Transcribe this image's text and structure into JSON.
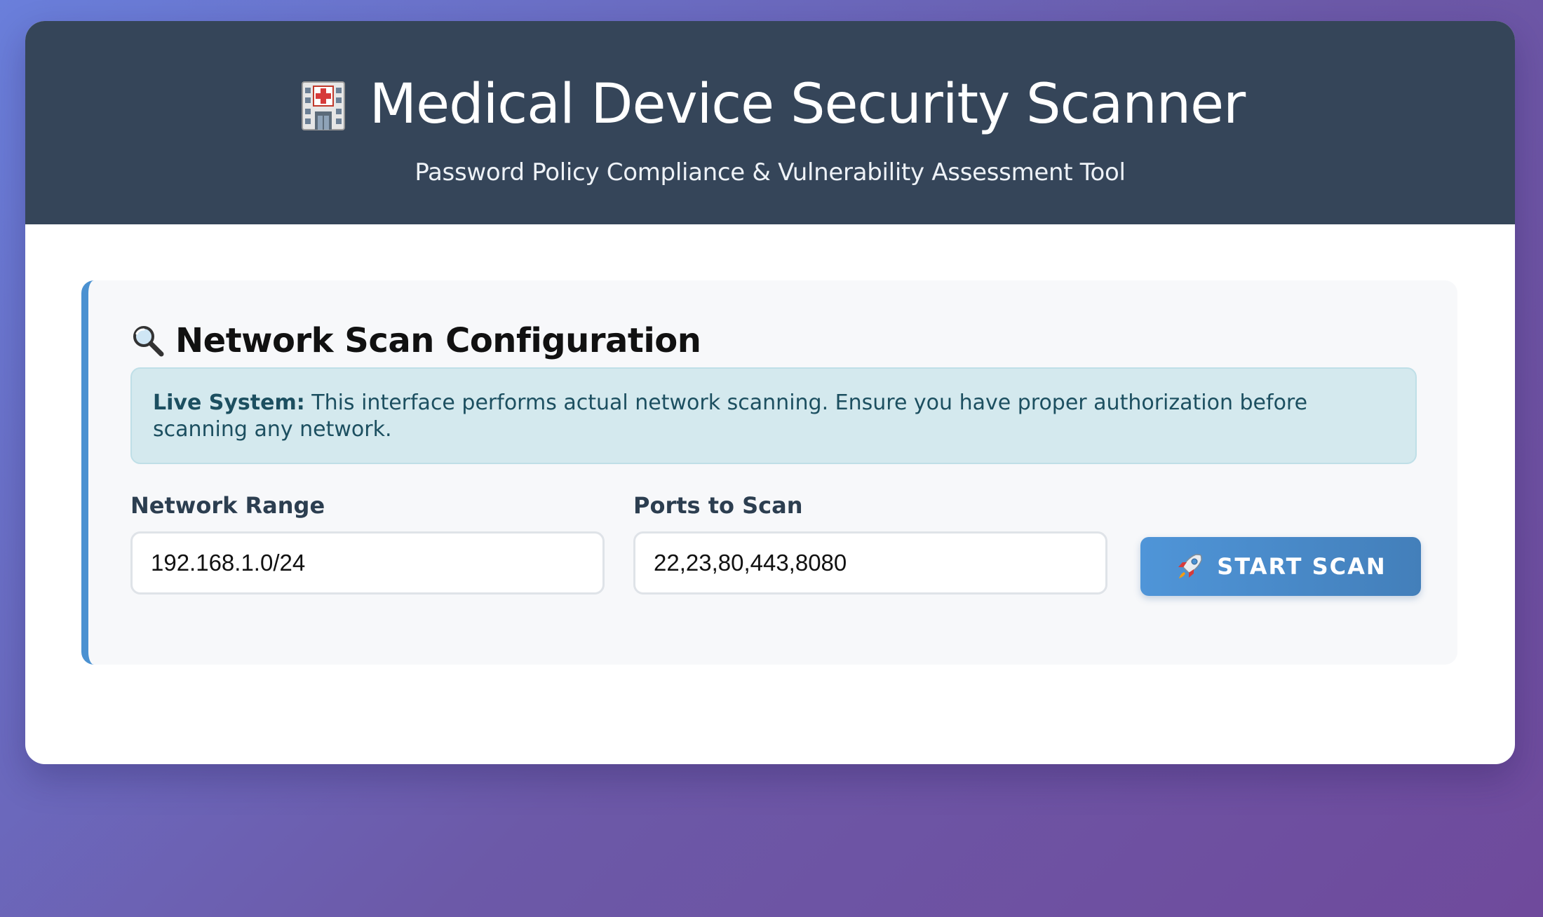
{
  "header": {
    "title": "Medical Device Security Scanner",
    "subtitle": "Password Policy Compliance & Vulnerability Assessment Tool",
    "icon": "hospital-icon"
  },
  "scan_config": {
    "title": "Network Scan Configuration",
    "icon": "magnifier-icon",
    "alert": {
      "strong": "Live System:",
      "message": " This interface performs actual network scanning. Ensure you have proper authorization before scanning any network."
    },
    "network_range": {
      "label": "Network Range",
      "value": "192.168.1.0/24"
    },
    "ports": {
      "label": "Ports to Scan",
      "value": "22,23,80,443,8080"
    },
    "start_button": {
      "label": "START SCAN",
      "icon": "rocket-icon"
    }
  },
  "colors": {
    "header_bg": "#354559",
    "accent": "#4b91d1",
    "alert_bg": "#d4e9ee",
    "alert_text": "#1c4f60",
    "button": "#4f95d8"
  }
}
